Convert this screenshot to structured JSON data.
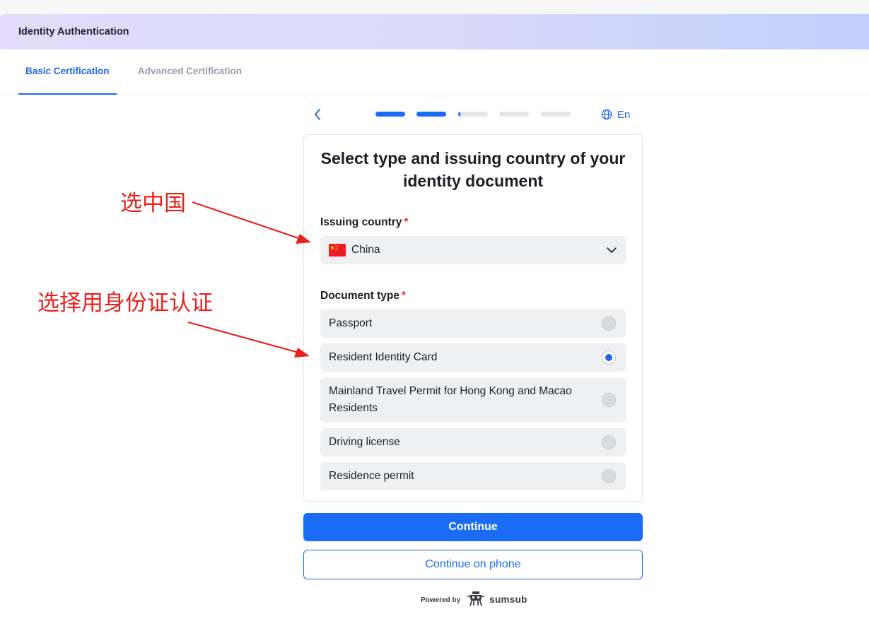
{
  "header": {
    "title": "Identity Authentication"
  },
  "tabs": [
    {
      "label": "Basic Certification",
      "active": true
    },
    {
      "label": "Advanced Certification",
      "active": false
    }
  ],
  "progress": {
    "total_steps": 5,
    "completed_steps": 2,
    "current_step_partial": true
  },
  "language": {
    "label": "En",
    "icon": "globe-icon"
  },
  "card": {
    "title": "Select type and issuing country of your identity document",
    "issuing_country": {
      "label": "Issuing country",
      "required_mark": "*",
      "value": "China",
      "flag_icon": "china-flag-icon"
    },
    "document_type": {
      "label": "Document type",
      "required_mark": "*",
      "options": [
        {
          "label": "Passport",
          "selected": false
        },
        {
          "label": "Resident Identity Card",
          "selected": true
        },
        {
          "label": "Mainland Travel Permit for Hong Kong and Macao Residents",
          "selected": false
        },
        {
          "label": "Driving license",
          "selected": false
        },
        {
          "label": "Residence permit",
          "selected": false
        }
      ]
    }
  },
  "buttons": {
    "continue": "Continue",
    "continue_phone": "Continue on phone"
  },
  "footer": {
    "powered_by": "Powered by",
    "brand": "sumsub"
  },
  "annotations": {
    "first": "选中国",
    "second": "选择用身份证认证"
  },
  "colors": {
    "accent": "#1a6cf6",
    "annotation": "#e8211b",
    "inactive_segment": "#e3e5e9"
  }
}
